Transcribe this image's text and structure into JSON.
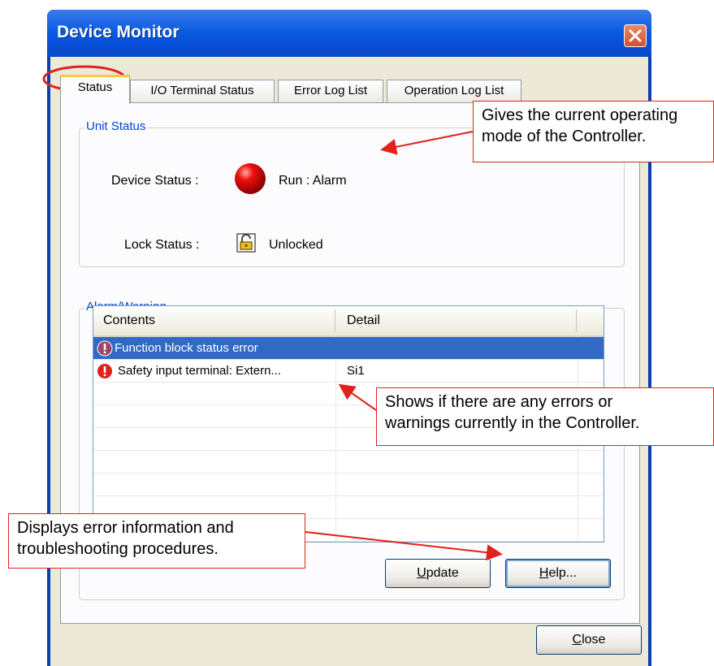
{
  "window": {
    "title": "Device Monitor"
  },
  "tabs": [
    {
      "label": "Status"
    },
    {
      "label": "I/O Terminal Status"
    },
    {
      "label": "Error Log List"
    },
    {
      "label": "Operation Log List"
    }
  ],
  "unit_status": {
    "group_title": "Unit Status",
    "device_status_label": "Device Status :",
    "device_status_value": "Run : Alarm",
    "device_status_icon": "red-status-lamp-icon",
    "lock_status_label": "Lock Status :",
    "lock_status_value": "Unlocked",
    "lock_icon": "unlocked-padlock-icon"
  },
  "alarm_warning": {
    "group_title": "Alarm/Warning",
    "columns": [
      "Contents",
      "Detail"
    ],
    "rows": [
      {
        "contents": "Function block status error",
        "detail": "",
        "icon": "warning-exclamation-icon",
        "selected": true
      },
      {
        "contents": "Safety input terminal: Extern...",
        "detail": "Si1",
        "icon": "error-exclamation-icon",
        "selected": false
      }
    ]
  },
  "buttons": {
    "update": {
      "prefix": "",
      "mnemonic": "U",
      "rest": "pdate"
    },
    "help": {
      "prefix": "",
      "mnemonic": "H",
      "rest": "elp..."
    },
    "close": {
      "prefix": "",
      "mnemonic": "C",
      "rest": "lose"
    }
  },
  "annotations": {
    "operating_mode": [
      "Gives the current operating",
      "mode of the Controller."
    ],
    "errors": [
      "Shows if there are any errors or",
      "warnings currently in the Controller."
    ],
    "help": [
      "Displays error information and",
      "troubleshooting procedures."
    ]
  },
  "colors": {
    "annotation_red": "#e2211c",
    "selection_blue": "#316ac5",
    "titlebar_blue": "#0650d8",
    "group_title_blue": "#0046d5"
  }
}
